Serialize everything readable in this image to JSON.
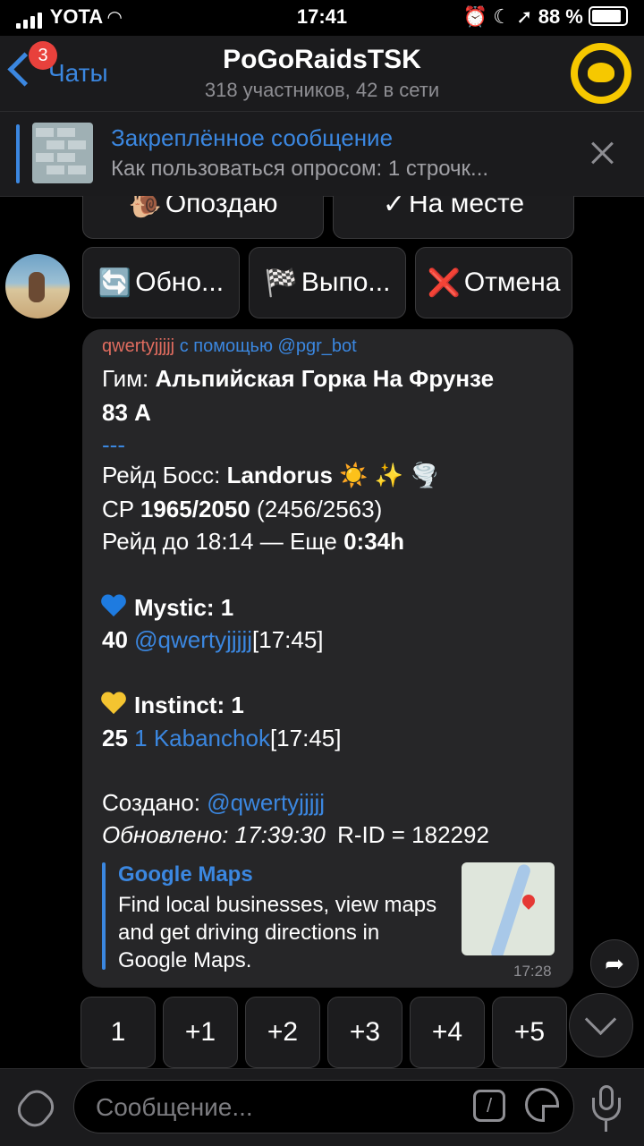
{
  "status_bar": {
    "carrier": "YOTA",
    "time": "17:41",
    "battery": "88 %"
  },
  "header": {
    "back_label": "Чаты",
    "unread_badge": "3",
    "title": "PoGoRaidsTSK",
    "subtitle": "318 участников, 42 в сети"
  },
  "pinned": {
    "title": "Закреплённое сообщение",
    "text": "Как пользоваться опросом: 1 строчк..."
  },
  "keyboard_top": [
    {
      "icon": "🐌",
      "label": "Опоздаю"
    },
    {
      "icon": "✓",
      "label": "На месте"
    }
  ],
  "keyboard_actions": [
    {
      "icon": "🔄",
      "label": "Обно..."
    },
    {
      "icon": "🏁",
      "label": "Выпо..."
    },
    {
      "icon": "❌",
      "label": "Отмена"
    }
  ],
  "message": {
    "sender": "qwertyjjjjj",
    "via_text": "с помощью",
    "via_bot": "@pgr_bot",
    "gym_label": "Гим:",
    "gym_name": "Альпийская Горка На Фрунзе",
    "gym_name_2": "83 А",
    "separator": "---",
    "boss_label": "Рейд Босс:",
    "boss_name": "Landorus",
    "boss_emoji": "☀️ ✨ 🌪️",
    "cp_label": "CP",
    "cp_value": "1965/2050",
    "cp_extra": "(2456/2563)",
    "raid_until": "Рейд до 18:14 — Еще",
    "raid_left": "0:34h",
    "team_mystic": "Mystic:  1",
    "mystic_level": "40",
    "mystic_user": "@qwertyjjjjj",
    "mystic_time": "[17:45]",
    "team_instinct": "Instinct:  1",
    "instinct_level": "25",
    "instinct_user": "1 Kabanchok",
    "instinct_time": "[17:45]",
    "created_label": "Создано:",
    "created_user": "@qwertyjjjjj",
    "updated": "Обновлено: 17:39:30",
    "rid": "R-ID = 182292",
    "preview_title": "Google Maps",
    "preview_desc": "Find local businesses, view maps and get driving directions in Google Maps.",
    "time": "17:28"
  },
  "vote_buttons": [
    "1",
    "+1",
    "+2",
    "+3",
    "+4",
    "+5"
  ],
  "input": {
    "placeholder": "Сообщение..."
  }
}
